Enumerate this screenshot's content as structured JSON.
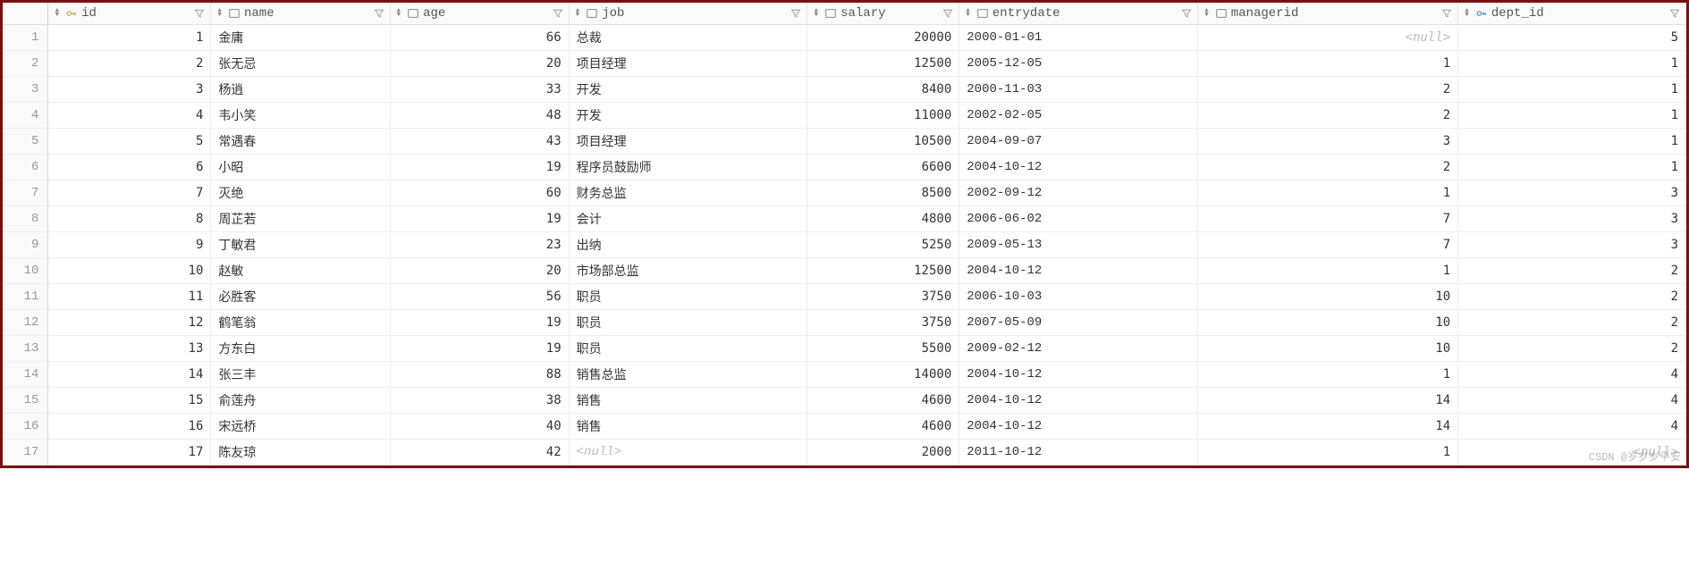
{
  "columns": [
    {
      "key": "id",
      "label": "id",
      "type": "key",
      "align": "num"
    },
    {
      "key": "name",
      "label": "name",
      "type": "text",
      "align": "txt"
    },
    {
      "key": "age",
      "label": "age",
      "type": "num",
      "align": "num"
    },
    {
      "key": "job",
      "label": "job",
      "type": "text",
      "align": "txt"
    },
    {
      "key": "salary",
      "label": "salary",
      "type": "num",
      "align": "num"
    },
    {
      "key": "entrydate",
      "label": "entrydate",
      "type": "text",
      "align": "txt"
    },
    {
      "key": "managerid",
      "label": "managerid",
      "type": "num",
      "align": "num"
    },
    {
      "key": "dept_id",
      "label": "dept_id",
      "type": "fkey",
      "align": "num"
    }
  ],
  "null_placeholder": "<null>",
  "rows": [
    {
      "n": 1,
      "id": 1,
      "name": "金庸",
      "age": 66,
      "job": "总裁",
      "salary": 20000,
      "entrydate": "2000-01-01",
      "managerid": null,
      "dept_id": 5
    },
    {
      "n": 2,
      "id": 2,
      "name": "张无忌",
      "age": 20,
      "job": "项目经理",
      "salary": 12500,
      "entrydate": "2005-12-05",
      "managerid": 1,
      "dept_id": 1
    },
    {
      "n": 3,
      "id": 3,
      "name": "杨逍",
      "age": 33,
      "job": "开发",
      "salary": 8400,
      "entrydate": "2000-11-03",
      "managerid": 2,
      "dept_id": 1
    },
    {
      "n": 4,
      "id": 4,
      "name": "韦小笑",
      "age": 48,
      "job": "开发",
      "salary": 11000,
      "entrydate": "2002-02-05",
      "managerid": 2,
      "dept_id": 1
    },
    {
      "n": 5,
      "id": 5,
      "name": "常遇春",
      "age": 43,
      "job": "项目经理",
      "salary": 10500,
      "entrydate": "2004-09-07",
      "managerid": 3,
      "dept_id": 1
    },
    {
      "n": 6,
      "id": 6,
      "name": "小昭",
      "age": 19,
      "job": "程序员鼓励师",
      "salary": 6600,
      "entrydate": "2004-10-12",
      "managerid": 2,
      "dept_id": 1
    },
    {
      "n": 7,
      "id": 7,
      "name": "灭绝",
      "age": 60,
      "job": "财务总监",
      "salary": 8500,
      "entrydate": "2002-09-12",
      "managerid": 1,
      "dept_id": 3
    },
    {
      "n": 8,
      "id": 8,
      "name": "周芷若",
      "age": 19,
      "job": "会计",
      "salary": 4800,
      "entrydate": "2006-06-02",
      "managerid": 7,
      "dept_id": 3
    },
    {
      "n": 9,
      "id": 9,
      "name": "丁敏君",
      "age": 23,
      "job": "出纳",
      "salary": 5250,
      "entrydate": "2009-05-13",
      "managerid": 7,
      "dept_id": 3
    },
    {
      "n": 10,
      "id": 10,
      "name": "赵敏",
      "age": 20,
      "job": "市场部总监",
      "salary": 12500,
      "entrydate": "2004-10-12",
      "managerid": 1,
      "dept_id": 2
    },
    {
      "n": 11,
      "id": 11,
      "name": "必胜客",
      "age": 56,
      "job": "职员",
      "salary": 3750,
      "entrydate": "2006-10-03",
      "managerid": 10,
      "dept_id": 2
    },
    {
      "n": 12,
      "id": 12,
      "name": "鹤笔翁",
      "age": 19,
      "job": "职员",
      "salary": 3750,
      "entrydate": "2007-05-09",
      "managerid": 10,
      "dept_id": 2
    },
    {
      "n": 13,
      "id": 13,
      "name": "方东白",
      "age": 19,
      "job": "职员",
      "salary": 5500,
      "entrydate": "2009-02-12",
      "managerid": 10,
      "dept_id": 2
    },
    {
      "n": 14,
      "id": 14,
      "name": "张三丰",
      "age": 88,
      "job": "销售总监",
      "salary": 14000,
      "entrydate": "2004-10-12",
      "managerid": 1,
      "dept_id": 4
    },
    {
      "n": 15,
      "id": 15,
      "name": "俞莲舟",
      "age": 38,
      "job": "销售",
      "salary": 4600,
      "entrydate": "2004-10-12",
      "managerid": 14,
      "dept_id": 4
    },
    {
      "n": 16,
      "id": 16,
      "name": "宋远桥",
      "age": 40,
      "job": "销售",
      "salary": 4600,
      "entrydate": "2004-10-12",
      "managerid": 14,
      "dept_id": 4
    },
    {
      "n": 17,
      "id": 17,
      "name": "陈友琼",
      "age": 42,
      "job": null,
      "salary": 2000,
      "entrydate": "2011-10-12",
      "managerid": 1,
      "dept_id": null
    }
  ],
  "watermark": "CSDN @岁岁岁平安"
}
